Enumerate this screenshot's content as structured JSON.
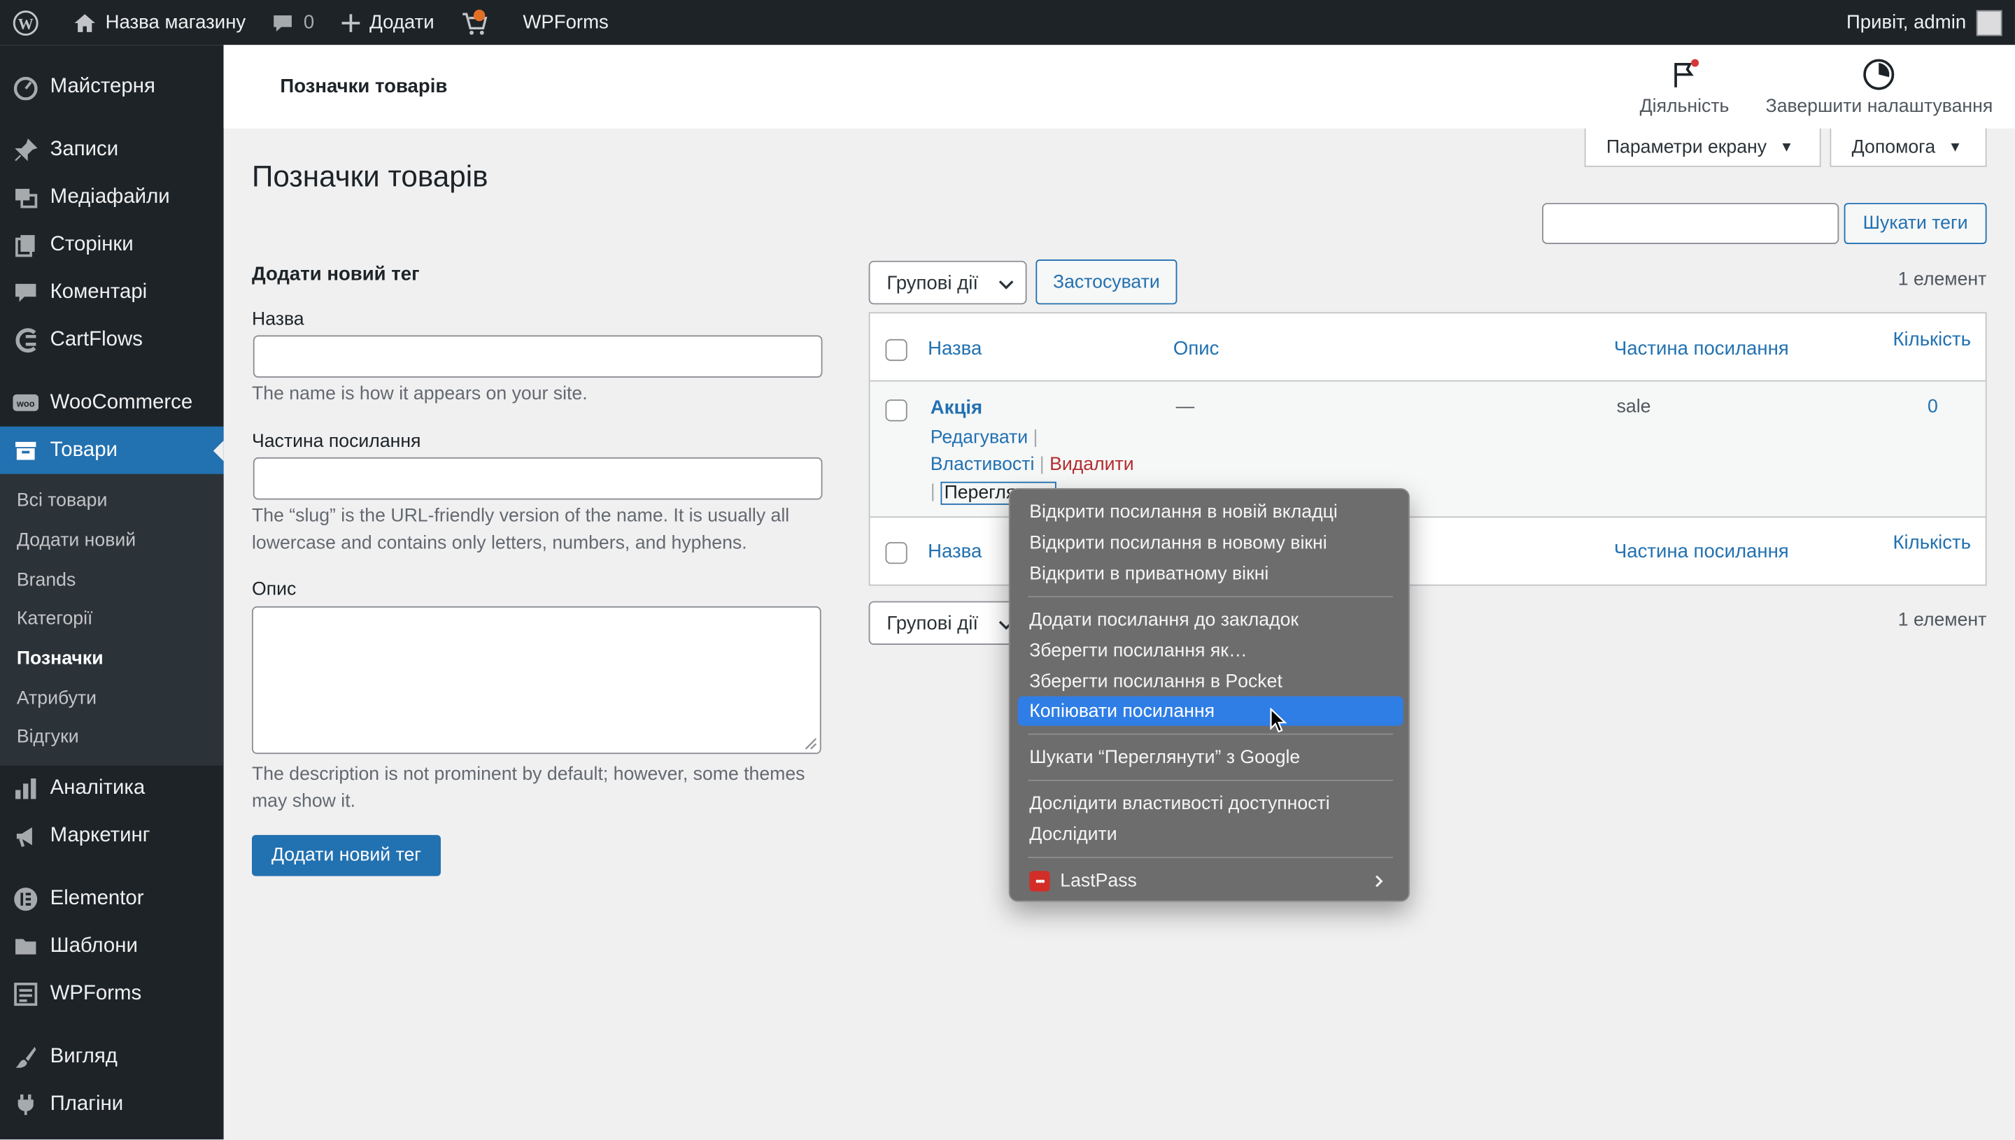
{
  "adminbar": {
    "site_name": "Назва магазину",
    "comments_count": "0",
    "new_label": "Додати",
    "wpforms_label": "WPForms",
    "greeting": "Привіт, admin"
  },
  "sidebar": {
    "items": [
      {
        "label": "Майстерня",
        "icon": "dashboard-icon"
      },
      {
        "label": "Записи",
        "icon": "pin-icon"
      },
      {
        "label": "Медіафайли",
        "icon": "media-icon"
      },
      {
        "label": "Сторінки",
        "icon": "pages-icon"
      },
      {
        "label": "Коментарі",
        "icon": "comment-icon"
      },
      {
        "label": "CartFlows",
        "icon": "cartflows-icon"
      },
      {
        "label": "WooCommerce",
        "icon": "woo-icon"
      },
      {
        "label": "Товари",
        "icon": "archive-icon"
      },
      {
        "label": "Аналітика",
        "icon": "chart-icon"
      },
      {
        "label": "Маркетинг",
        "icon": "megaphone-icon"
      },
      {
        "label": "Elementor",
        "icon": "elementor-icon"
      },
      {
        "label": "Шаблони",
        "icon": "folder-icon"
      },
      {
        "label": "WPForms",
        "icon": "forms-icon"
      },
      {
        "label": "Вигляд",
        "icon": "brush-icon"
      },
      {
        "label": "Плагіни",
        "icon": "plugin-icon"
      }
    ],
    "submenu": [
      "Всі товари",
      "Додати новий",
      "Brands",
      "Категорії",
      "Позначки",
      "Атрибути",
      "Відгуки"
    ]
  },
  "header": {
    "title": "Позначки товарів",
    "activity": "Діяльність",
    "finish_setup": "Завершити налаштування"
  },
  "screen_options": "Параметри екрану",
  "help": "Допомога",
  "page_title": "Позначки товарів",
  "search": {
    "value": "",
    "button": "Шукати теги"
  },
  "form": {
    "heading": "Додати новий тег",
    "name_label": "Назва",
    "name_help": "The name is how it appears on your site.",
    "slug_label": "Частина посилання",
    "slug_help": "The “slug” is the URL-friendly version of the name. It is usually all lowercase and contains only letters, numbers, and hyphens.",
    "desc_label": "Опис",
    "desc_help": "The description is not prominent by default; however, some themes may show it.",
    "submit": "Додати новий тег"
  },
  "bulk": {
    "select": "Групові дії",
    "apply": "Застосувати",
    "count": "1 елемент"
  },
  "table": {
    "columns": {
      "name": "Назва",
      "description": "Опис",
      "slug": "Частина посилання",
      "count": "Кількість"
    },
    "rows": [
      {
        "name": "Акція",
        "description": "—",
        "slug": "sale",
        "count": "0"
      }
    ],
    "row_actions": {
      "edit": "Редагувати",
      "properties": "Властивості",
      "delete": "Видалити",
      "view": "Перегля"
    }
  },
  "context_menu": {
    "groups": [
      [
        "Відкрити посилання в новій вкладці",
        "Відкрити посилання в новому вікні",
        "Відкрити в приватному вікні"
      ],
      [
        "Додати посилання до закладок",
        "Зберегти посилання як…",
        "Зберегти посилання в Pocket",
        "Копіювати посилання"
      ],
      [
        "Шукати “Переглянути” з Google"
      ],
      [
        "Дослідити властивості доступності",
        "Дослідити"
      ],
      [
        "LastPass"
      ]
    ],
    "highlighted": "Копіювати посилання",
    "lastpass_icon_text": "•••"
  },
  "colors": {
    "accent": "#2271b1",
    "adminbar": "#1d2327",
    "delete": "#b32d2e",
    "highlight": "#2f7ee6"
  }
}
